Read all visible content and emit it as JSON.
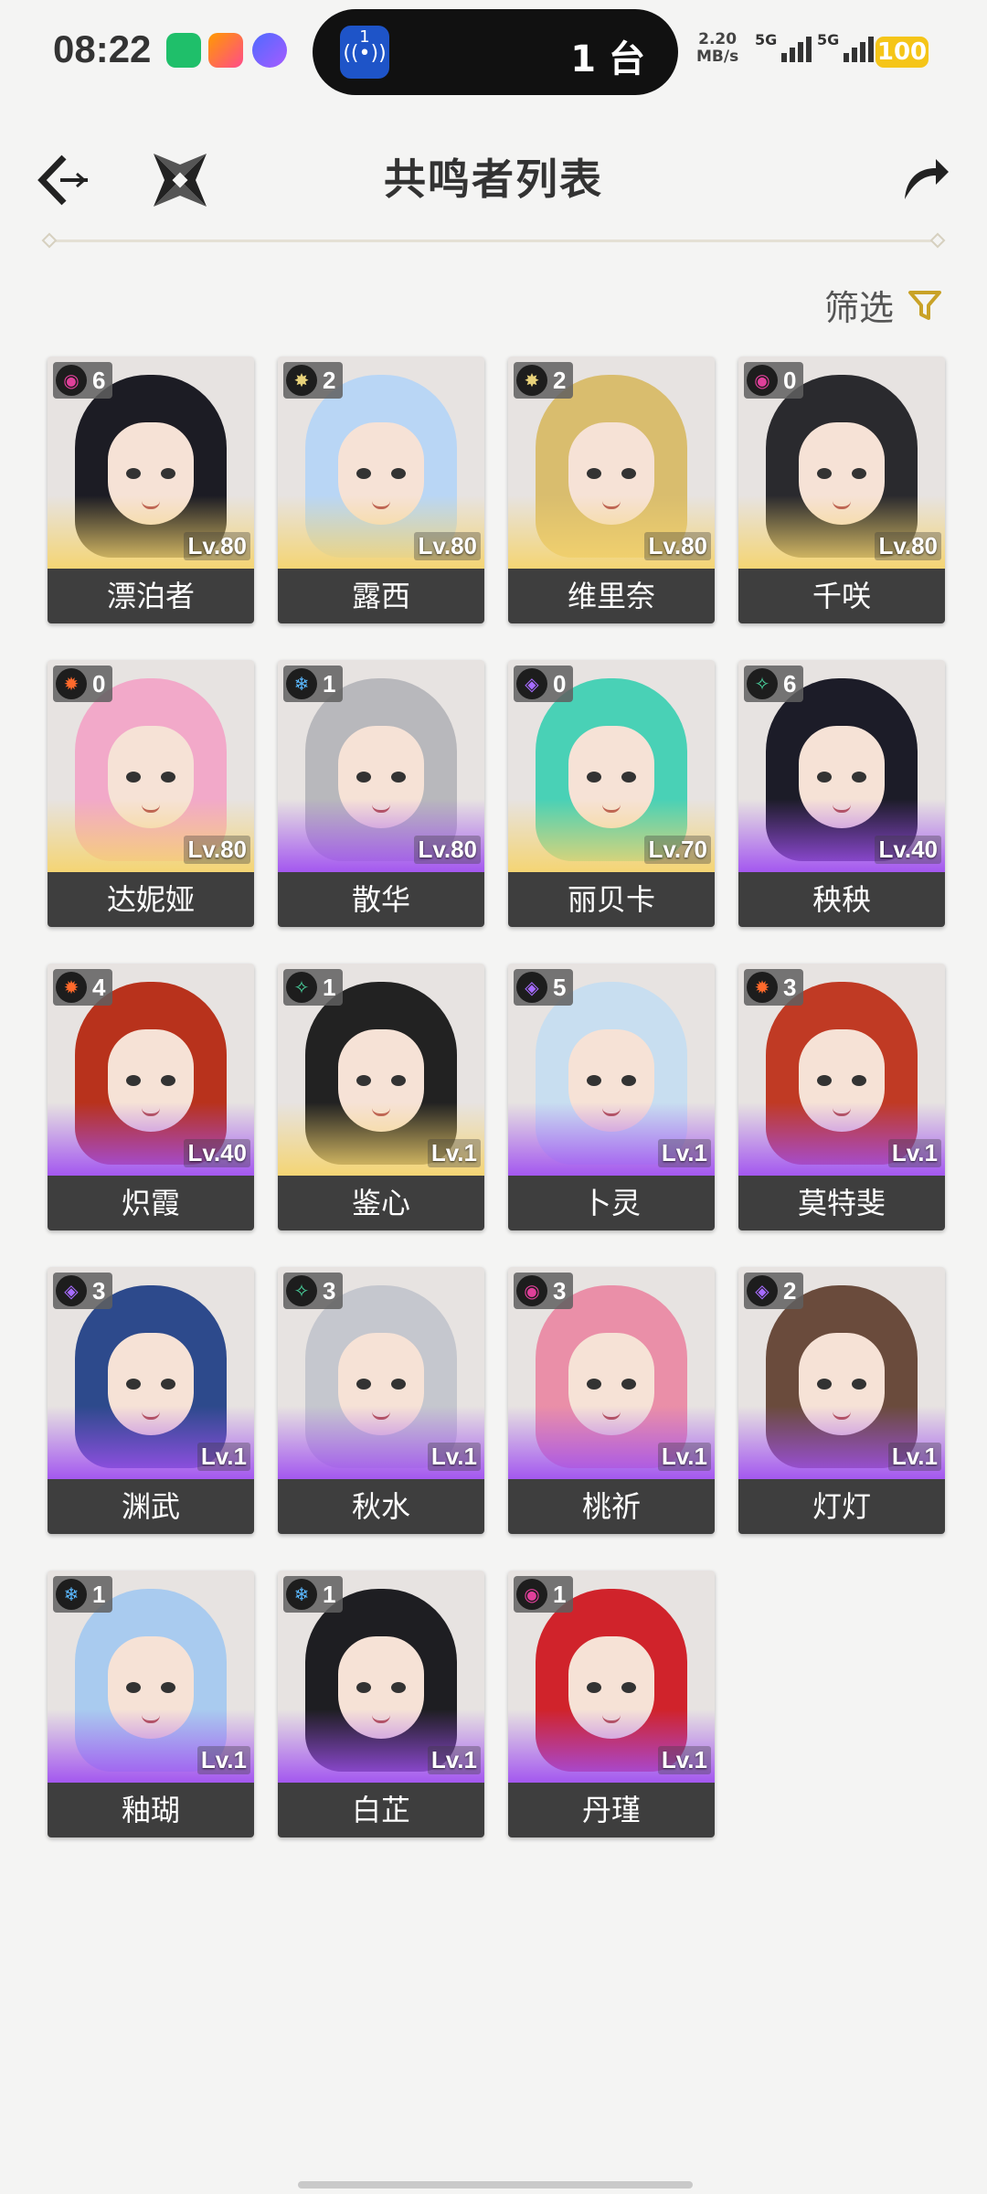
{
  "status": {
    "time": "08:22",
    "island_count": "1",
    "island_text": "1 台",
    "net_speed": "2.20",
    "net_unit": "MB/s",
    "sim1": "5G",
    "sim2": "5G",
    "battery": "100"
  },
  "header": {
    "title": "共鸣者列表",
    "filter_label": "筛选"
  },
  "colors": {
    "accent": "#c9a227",
    "five_star": "#f0d070",
    "four_star": "#a050f0",
    "name_bar": "#3e3e3e"
  },
  "resonators": [
    {
      "name": "漂泊者",
      "level": "Lv.80",
      "sequence": "6",
      "element": "havoc",
      "rarity": 5,
      "hair": "#1c1c24"
    },
    {
      "name": "露西",
      "level": "Lv.80",
      "sequence": "2",
      "element": "spectro",
      "rarity": 5,
      "hair": "#b9d6f5"
    },
    {
      "name": "维里奈",
      "level": "Lv.80",
      "sequence": "2",
      "element": "spectro",
      "rarity": 5,
      "hair": "#d9bd6e"
    },
    {
      "name": "千咲",
      "level": "Lv.80",
      "sequence": "0",
      "element": "havoc",
      "rarity": 5,
      "hair": "#2a2a2e"
    },
    {
      "name": "达妮娅",
      "level": "Lv.80",
      "sequence": "0",
      "element": "fusion",
      "rarity": 5,
      "hair": "#f2a9c9"
    },
    {
      "name": "散华",
      "level": "Lv.80",
      "sequence": "1",
      "element": "glacio",
      "rarity": 4,
      "hair": "#b8b8bc"
    },
    {
      "name": "丽贝卡",
      "level": "Lv.70",
      "sequence": "0",
      "element": "electro",
      "rarity": 5,
      "hair": "#49d1b6"
    },
    {
      "name": "秧秧",
      "level": "Lv.40",
      "sequence": "6",
      "element": "aero",
      "rarity": 4,
      "hair": "#1c1c28"
    },
    {
      "name": "炽霞",
      "level": "Lv.40",
      "sequence": "4",
      "element": "fusion",
      "rarity": 4,
      "hair": "#b8321c"
    },
    {
      "name": "鉴心",
      "level": "Lv.1",
      "sequence": "1",
      "element": "aero",
      "rarity": 5,
      "hair": "#222222"
    },
    {
      "name": "卜灵",
      "level": "Lv.1",
      "sequence": "5",
      "element": "electro",
      "rarity": 4,
      "hair": "#c8def0"
    },
    {
      "name": "莫特斐",
      "level": "Lv.1",
      "sequence": "3",
      "element": "fusion",
      "rarity": 4,
      "hair": "#c03a24"
    },
    {
      "name": "渊武",
      "level": "Lv.1",
      "sequence": "3",
      "element": "electro",
      "rarity": 4,
      "hair": "#2d4a8c"
    },
    {
      "name": "秋水",
      "level": "Lv.1",
      "sequence": "3",
      "element": "aero",
      "rarity": 4,
      "hair": "#c5c7ce"
    },
    {
      "name": "桃祈",
      "level": "Lv.1",
      "sequence": "3",
      "element": "havoc",
      "rarity": 4,
      "hair": "#ea8fa8"
    },
    {
      "name": "灯灯",
      "level": "Lv.1",
      "sequence": "2",
      "element": "electro",
      "rarity": 4,
      "hair": "#6a4b3c"
    },
    {
      "name": "釉瑚",
      "level": "Lv.1",
      "sequence": "1",
      "element": "glacio",
      "rarity": 4,
      "hair": "#a9cbef"
    },
    {
      "name": "白芷",
      "level": "Lv.1",
      "sequence": "1",
      "element": "glacio",
      "rarity": 4,
      "hair": "#1e1e22"
    },
    {
      "name": "丹瑾",
      "level": "Lv.1",
      "sequence": "1",
      "element": "havoc",
      "rarity": 4,
      "hair": "#d0232b"
    }
  ],
  "element_icons": {
    "havoc": {
      "glyph": "◉",
      "color": "#e0409a"
    },
    "spectro": {
      "glyph": "✸",
      "color": "#e8d27a"
    },
    "fusion": {
      "glyph": "✹",
      "color": "#ff6a2c"
    },
    "glacio": {
      "glyph": "❄",
      "color": "#5ab8ff"
    },
    "electro": {
      "glyph": "◈",
      "color": "#a66bff"
    },
    "aero": {
      "glyph": "✧",
      "color": "#4ad6a0"
    }
  }
}
